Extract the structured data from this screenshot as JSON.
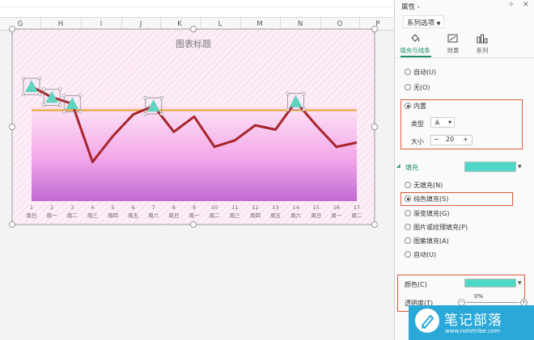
{
  "spreadsheet": {
    "columns": [
      "G",
      "H",
      "I",
      "J",
      "K",
      "L",
      "M",
      "N",
      "O",
      "P"
    ]
  },
  "chart_data": {
    "type": "line",
    "title": "图表标题",
    "categories": [
      {
        "num": "1",
        "day": "周日"
      },
      {
        "num": "2",
        "day": "周一"
      },
      {
        "num": "3",
        "day": "周二"
      },
      {
        "num": "4",
        "day": "周三"
      },
      {
        "num": "5",
        "day": "周四"
      },
      {
        "num": "6",
        "day": "周五"
      },
      {
        "num": "7",
        "day": "周六"
      },
      {
        "num": "8",
        "day": "周日"
      },
      {
        "num": "9",
        "day": "周一"
      },
      {
        "num": "10",
        "day": "周二"
      },
      {
        "num": "11",
        "day": "周三"
      },
      {
        "num": "12",
        "day": "周四"
      },
      {
        "num": "13",
        "day": "周五"
      },
      {
        "num": "14",
        "day": "周六"
      },
      {
        "num": "15",
        "day": "周日"
      },
      {
        "num": "16",
        "day": "周一"
      },
      {
        "num": "17",
        "day": "周二"
      }
    ],
    "series": [
      {
        "values": [
          88,
          83,
          80,
          53,
          65,
          75,
          79,
          67,
          74,
          60,
          63,
          70,
          68,
          81,
          70,
          60,
          62
        ]
      },
      {
        "values": [
          77,
          77,
          77,
          77,
          77,
          77,
          77,
          77,
          77,
          77,
          77,
          77,
          77,
          77,
          77,
          77,
          77
        ]
      }
    ],
    "marker_indices": [
      0,
      1,
      2,
      6,
      13
    ],
    "ylim": [
      30,
      100
    ],
    "colors": {
      "line": "#a8242a",
      "target": "#f0a22c",
      "marker": "#5fd3c0",
      "area_top": "#fbe1f3",
      "area_bottom": "#c16ad2"
    }
  },
  "panel": {
    "title": "属性 -",
    "icons": [
      "pin-icon",
      "close-icon"
    ],
    "series_options": "系列选项",
    "tabs": [
      {
        "label": "填充与线条",
        "active": true
      },
      {
        "label": "效果"
      },
      {
        "label": "系列"
      }
    ],
    "marker_options": [
      {
        "label": "自动(U)",
        "checked": false
      },
      {
        "label": "无(O)",
        "checked": false
      },
      {
        "label": "内置",
        "checked": true
      }
    ],
    "type_label": "类型",
    "type_value": "▲",
    "size_label": "大小",
    "size_value": "20",
    "size_minus": "−",
    "size_plus": "+",
    "fill_header": "填充",
    "fill_options": [
      {
        "label": "无填充(N)",
        "checked": false
      },
      {
        "label": "纯色填充(S)",
        "checked": true
      },
      {
        "label": "渐变填充(G)",
        "checked": false
      },
      {
        "label": "图片或纹理填充(P)",
        "checked": false
      },
      {
        "label": "图案填充(A)",
        "checked": false
      },
      {
        "label": "自动(U)",
        "checked": false
      }
    ],
    "color_label": "颜色(C)",
    "transparency_label": "透明度(T)",
    "transparency_value": "0%",
    "fill_color": "#4fd8c8"
  },
  "watermark": {
    "title": "笔记部落",
    "url": "www.notetribe.com"
  }
}
